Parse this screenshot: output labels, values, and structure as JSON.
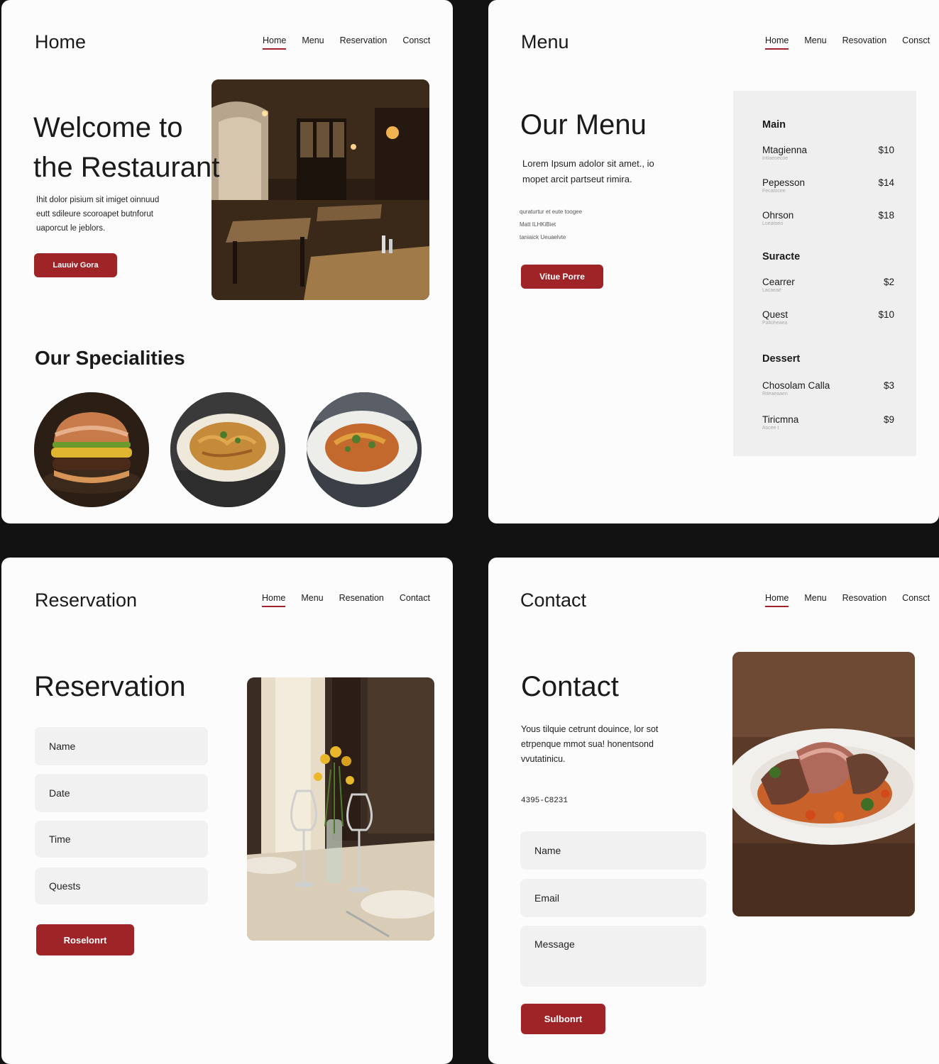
{
  "nav_home": {
    "home": "Home",
    "menu": "Menu",
    "reservation": "Reservation",
    "contact": "Consct"
  },
  "nav_menu": {
    "home": "Home",
    "menu": "Menu",
    "reservation": "Resovation",
    "contact": "Consct"
  },
  "nav_res": {
    "home": "Home",
    "menu": "Menu",
    "reservation": "Resenation",
    "contact": "Contact"
  },
  "nav_contact": {
    "home": "Home",
    "menu": "Menu",
    "reservation": "Resovation",
    "contact": "Consct"
  },
  "home": {
    "page_title": "Home",
    "hero_line1": "Welcome to",
    "hero_line2": "the Restaurant",
    "body_line1": "Ihit  dolor pisium sit imiget oinnuud",
    "body_line2": "eutt sdileure scoroapet butnforut",
    "body_line3": "uaporcut le jeblors.",
    "button": "Lauuiv Gora",
    "specialities_heading": "Our Specialities"
  },
  "menu": {
    "page_title": "Menu",
    "heading": "Our Menu",
    "body_line1": "Lorem Ipsum adolor sit amet., io",
    "body_line2": "mopet arcit partseut rimira.",
    "small_line1": "quraturtur et eute toogee",
    "small_line2": "Matt ILHKiBiet",
    "small_line3": "taniaick Ueuaelvte",
    "button": "Vitue Porre",
    "sections": [
      {
        "title": "Main",
        "items": [
          {
            "name": "Mtagienna",
            "price": "$10",
            "desc": "Intiaeoecoe"
          },
          {
            "name": "Pepesson",
            "price": "$14",
            "desc": "Fecatocee"
          },
          {
            "name": "Ohrson",
            "price": "$18",
            "desc": "Loeatoeo"
          }
        ]
      },
      {
        "title": "Suracte",
        "items": [
          {
            "name": "Cearrer",
            "price": "$2",
            "desc": "Lacaeae"
          },
          {
            "name": "Quest",
            "price": "$10",
            "desc": "Paltoheaea"
          }
        ]
      },
      {
        "title": "Dessert",
        "items": [
          {
            "name": "Chosolam Calla",
            "price": "$3",
            "desc": "Riteaeaaen"
          },
          {
            "name": "Tiricmna",
            "price": "$9",
            "desc": "Ascee   t"
          }
        ]
      }
    ]
  },
  "reservation": {
    "page_title": "Reservation",
    "heading": "Reservation",
    "fields": {
      "name": "Name",
      "date": "Date",
      "time": "Time",
      "guests": "Quests"
    },
    "button": "Roselonrt"
  },
  "contact": {
    "page_title": "Contact",
    "heading": "Contact",
    "body_line1": "Yous tilquie cetrunt douince, lor sot",
    "body_line2": "etrpenque mmot sua! honentsond",
    "body_line3": "vvutatinicu.",
    "phone": "4395-C8231",
    "fields": {
      "name": "Name",
      "email": "Email",
      "message": "Message"
    },
    "button": "Sulbonrt"
  },
  "colors": {
    "accent": "#9e2428",
    "background": "#121212",
    "panel": "#fcfcfc",
    "field": "#f1f1f1"
  }
}
